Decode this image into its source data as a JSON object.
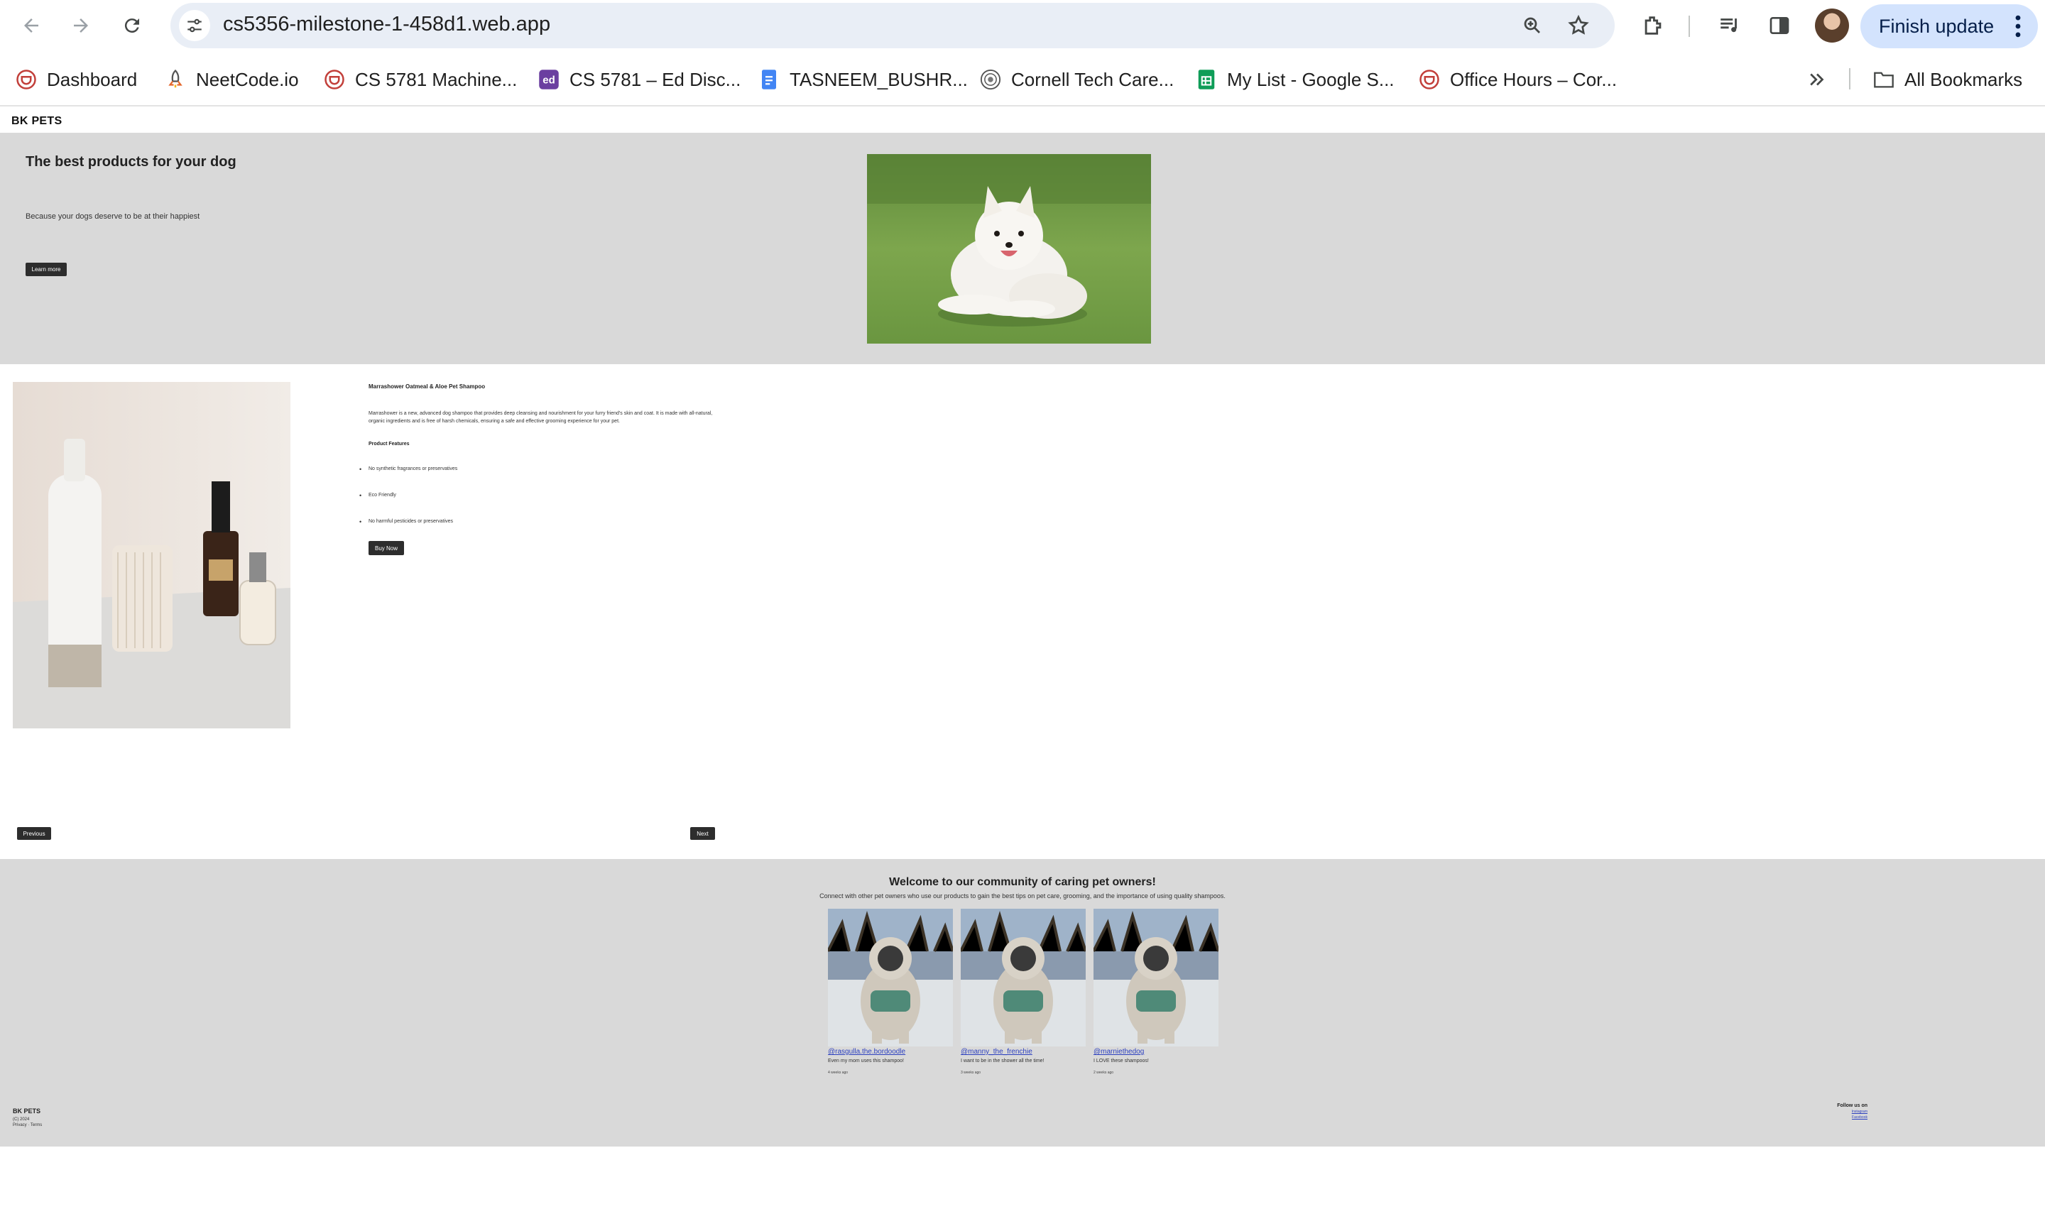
{
  "browser": {
    "url": "cs5356-milestone-1-458d1.web.app",
    "finish_update": "Finish update",
    "bookmarks": [
      {
        "label": "Dashboard",
        "icon": "canvas-icon"
      },
      {
        "label": "NeetCode.io",
        "icon": "rocket-icon"
      },
      {
        "label": "CS 5781 Machine...",
        "icon": "canvas-icon"
      },
      {
        "label": "CS 5781 – Ed Disc...",
        "icon": "ed-icon"
      },
      {
        "label": "TASNEEM_BUSHR...",
        "icon": "google-docs-icon"
      },
      {
        "label": "Cornell Tech Care...",
        "icon": "cornell-seal-icon"
      },
      {
        "label": "My List - Google S...",
        "icon": "google-sheets-icon"
      },
      {
        "label": "Office Hours – Cor...",
        "icon": "canvas-icon"
      }
    ],
    "all_bookmarks": "All Bookmarks",
    "ed_glyph": "ed",
    "colors": {
      "canvas_red": "#c23f3a",
      "ed_purple": "#6b3fa0",
      "docs_blue": "#4285f4",
      "sheets_green": "#0f9d58",
      "finish_bg": "#d3e3fd"
    }
  },
  "site": {
    "brand": "BK PETS",
    "hero": {
      "title": "The best products for your dog",
      "subtitle": "Because your dogs deserve to be at their happiest",
      "cta": "Learn more"
    },
    "product": {
      "name": "Marrashower Oatmeal & Aloe Pet Shampoo",
      "description": "Marrashower is a new, advanced dog shampoo that provides deep cleansing and nourishment for your furry friend's skin and coat. It is made with all-natural, organic ingredients and is free of harsh chemicals, ensuring a safe and effective grooming experience for your pet.",
      "features_title": "Product Features",
      "features": [
        "No synthetic fragrances or preservatives",
        "Eco Friendly",
        "No harmful pesticides or preservatives"
      ],
      "buy": "Buy Now",
      "prev": "Previous",
      "next": "Next"
    },
    "community": {
      "title": "Welcome to our community of caring pet owners!",
      "subtitle": "Connect with other pet owners who use our products to gain the best tips on pet care, grooming, and the importance of using quality shampoos.",
      "posts": [
        {
          "handle": "@rasgulla.the.bordoodle",
          "quote": "Even my mom uses this shampoo!",
          "ago": "4 weeks ago"
        },
        {
          "handle": "@manny_the_frenchie",
          "quote": "I want to be in the shower all the time!",
          "ago": "3 weeks ago"
        },
        {
          "handle": "@marniethedog",
          "quote": "I LOVE these shampoos!",
          "ago": "2 weeks ago"
        }
      ]
    },
    "footer": {
      "brand": "BK PETS",
      "copyright": "(C) 2024",
      "links": "Privacy · Terms",
      "follow_title": "Follow us on",
      "social": [
        "Instagram",
        "Facebook"
      ]
    }
  }
}
